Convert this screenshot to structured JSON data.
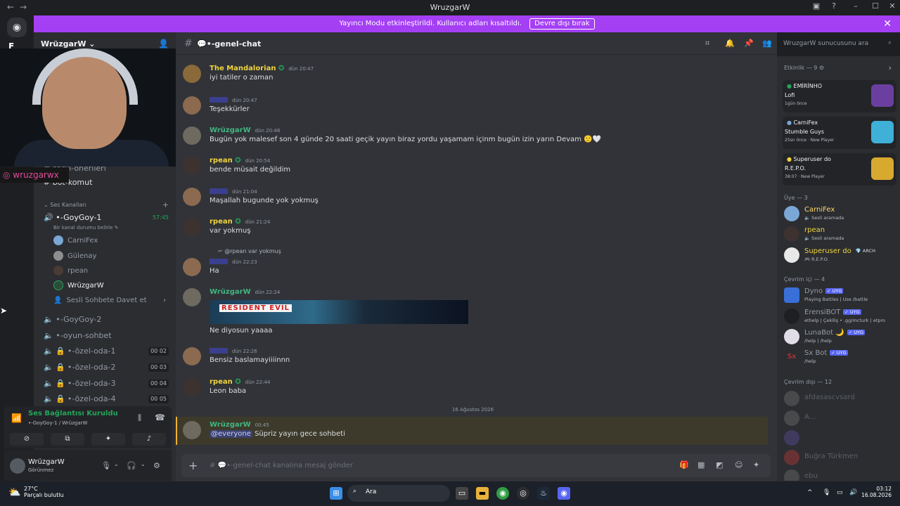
{
  "window": {
    "title": "WruzgarW",
    "nav_back": "←",
    "nav_fwd": "→",
    "inbox": "▣",
    "help": "?",
    "min": "–",
    "max": "☐",
    "close": "✕"
  },
  "banner": {
    "text": "Yayıncı Modu etkinleştirildi. Kullanıcı adları kısaltıldı.",
    "button": "Devre dışı bırak",
    "close": "✕"
  },
  "rail": {
    "home": "◉",
    "server_label": "F"
  },
  "server": {
    "name": "WrüzgarW ⌄",
    "add_icon": "👤"
  },
  "channels": {
    "text": [
      {
        "name": "şarkı-önerileri"
      },
      {
        "name": "bot-komut"
      }
    ],
    "voice_category": "Ses Kanalları",
    "voice_add": "+",
    "active_voice": {
      "name": "•-GoyGoy-1",
      "timer": "57:45",
      "status": "Bir kanal durumu belirle ✎"
    },
    "voice_users": [
      "CarniFex",
      "Gülenay",
      "rpean",
      "WrüzgarW"
    ],
    "invite": "Sesli Sohbete Davet et",
    "voice": [
      {
        "name": "•-GoyGoy-2",
        "count": ""
      },
      {
        "name": "•-oyun-sohbet",
        "count": ""
      },
      {
        "name": "•-özel-oda-1",
        "count": "00 02"
      },
      {
        "name": "•-özel-oda-2",
        "count": "00 03"
      },
      {
        "name": "•-özel-oda-3",
        "count": "00 04"
      },
      {
        "name": "•-özel-oda-4",
        "count": "00 05"
      }
    ]
  },
  "overlay": {
    "instagram": "wruzgarwx"
  },
  "voice_panel": {
    "status": "Ses Bağlantısı Kuruldu",
    "sub": "•-GoyGoy-1 / WrüzgarW"
  },
  "user_panel": {
    "name": "WrüzgarW",
    "status": "Görünmez"
  },
  "chat": {
    "channel": "💬•-genel-chat",
    "placeholder": "# 💬•-genel-chat kanalına mesaj gönder",
    "date_separator": "16 Ağustos 2026",
    "messages": [
      {
        "author": "The Mandalorian",
        "time": "dün 20:47",
        "text": "iyi tatiler o zaman",
        "color": "#f0d43c"
      },
      {
        "author": "",
        "time": "dün 20:47",
        "text": "Teşekkürler",
        "color": "#6a4ccf"
      },
      {
        "author": "WrüzgarW",
        "time": "dün 20:48",
        "text": "Bugün yok malesef son 4 günde 20 saati geçik yayın biraz yordu yaşamam içinm bugün izin  yarın Devam 🙂🤍",
        "color": "#43b581"
      },
      {
        "author": "rpean",
        "time": "dün 20:54",
        "text": "bende müsait değildim",
        "color": "#f0d43c"
      },
      {
        "author": "",
        "time": "dün 21:04",
        "text": "Maşallah bugunde yok yokmuş",
        "color": "#6a4ccf"
      },
      {
        "author": "rpean",
        "time": "dün 21:24",
        "text": "var yokmuş",
        "color": "#f0d43c"
      },
      {
        "author": "",
        "time": "dün 22:23",
        "text": "Ha",
        "color": "#6a4ccf",
        "reply": "@rpean var yokmuş"
      },
      {
        "author": "WrüzgarW",
        "time": "dün 22:24",
        "text": "Ne diyosun yaaaa",
        "color": "#43b581",
        "embed": "RESIDENT EVIL"
      },
      {
        "author": "",
        "time": "dün 22:26",
        "text": "Bensiz baslamayiiiinnn",
        "color": "#6a4ccf"
      },
      {
        "author": "rpean",
        "time": "dün 22:44",
        "text": "Leon baba",
        "color": "#f0d43c"
      },
      {
        "author": "WrüzgarW",
        "time": "00:45",
        "mention": "@everyone",
        "text": "Süpriz yayın gece sohbeti",
        "color": "#43b581"
      }
    ]
  },
  "search": {
    "placeholder": "WruzgarW sunucusunu ara"
  },
  "members": {
    "activity_header": "Etkinlik — 9 ⚙",
    "activities": [
      {
        "name": "EMİRİNHO",
        "game": "Lofi",
        "time": "1gün önce"
      },
      {
        "name": "CarniFex",
        "game": "Stumble Guys",
        "time": "25sn önce  ·  New Player"
      },
      {
        "name": "Superuser do",
        "game": "R.E.P.O.",
        "time": "38:07  ·  New Player"
      }
    ],
    "member_header": "Üye — 3",
    "members": [
      {
        "name": "CarniFex",
        "status": "🔈 Sesli aramada",
        "color": "#ffd86b"
      },
      {
        "name": "rpean",
        "status": "🔈 Sesli aramada",
        "color": "#f0d43c"
      },
      {
        "name": "Superuser do",
        "status": "🎮 R.E.P.O.",
        "tag": "💎 ARCH",
        "color": "#f0d43c"
      }
    ],
    "online_header": "Çevrim içi — 4",
    "online": [
      {
        "name": "Dyno",
        "status": "Playing Battles | Use /battle",
        "tag": "✓ UYG"
      },
      {
        "name": "ErensiBOT",
        "status": "ethelp | Çekiliş • .gg/mcturk | etpro",
        "tag": "✓ UYG"
      },
      {
        "name": "LunaBot 🌙",
        "status": "/help | /help",
        "tag": "✓ UYG"
      },
      {
        "name": "Sx Bot",
        "status": "/help",
        "tag": "✓ UYG"
      }
    ],
    "offline_header": "Çevrim dışı — 12",
    "offline": [
      "afdasascvsard",
      "A...",
      "",
      "Buğra Türkmen",
      "ebu"
    ]
  },
  "taskbar": {
    "temp": "27°C",
    "weather": "Parçalı bulutlu",
    "search": "Ara",
    "time": "03:12",
    "date": "16.08.2026"
  }
}
